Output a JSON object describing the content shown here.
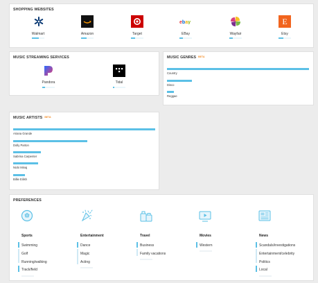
{
  "shopping": {
    "title": "SHOPPING WEBSITES",
    "sites": [
      {
        "name": "Walmart",
        "icon": "walmart-spark-icon",
        "color": "#0b3a74",
        "level": 0.55
      },
      {
        "name": "Amazon",
        "icon": "amazon-smile-icon",
        "color": "#111111",
        "level": 0.45
      },
      {
        "name": "Target",
        "icon": "target-bullseye-icon",
        "color": "#cc0000",
        "level": 0.35
      },
      {
        "name": "EBay",
        "icon": "ebay-logo-icon",
        "color": "#ffffff",
        "level": 0.25
      },
      {
        "name": "Wayfair",
        "icon": "wayfair-pinwheel-icon",
        "color": "#7b2d8e",
        "level": 0.3
      },
      {
        "name": "Etsy",
        "icon": "etsy-e-icon",
        "color": "#f1641e",
        "letter": "E",
        "level": 0.4
      }
    ]
  },
  "music_services": {
    "title": "MUSIC STREAMING SERVICES",
    "services": [
      {
        "name": "Pandora",
        "icon": "pandora-p-icon",
        "color": "#3668ff",
        "level": 0.2
      },
      {
        "name": "Tidal",
        "icon": "tidal-dots-icon",
        "color": "#000000",
        "level": 0.1
      }
    ]
  },
  "music_genres": {
    "title": "MUSIC GENRES",
    "badge": "BETA",
    "items": [
      {
        "name": "Country",
        "value": 1.0
      },
      {
        "name": "Disco",
        "value": 0.17
      },
      {
        "name": "Reggae",
        "value": 0.05
      }
    ]
  },
  "music_artists": {
    "title": "MUSIC ARTISTS",
    "badge": "BETA",
    "items": [
      {
        "name": "Ariana Grande",
        "value": 1.0
      },
      {
        "name": "Dolly Parton",
        "value": 0.51
      },
      {
        "name": "Sabrina Carpenter",
        "value": 0.19
      },
      {
        "name": "Nicki Minaj",
        "value": 0.17
      },
      {
        "name": "Billie Eilish",
        "value": 0.08
      }
    ]
  },
  "preferences": {
    "title": "PREFERENCES",
    "categories": [
      {
        "name": "Sports",
        "icon": "soccer-ball-icon",
        "items": [
          "Swimming",
          "Golf",
          "Running/walking",
          "Track/field"
        ],
        "active": [
          0,
          3
        ]
      },
      {
        "name": "Entertainment",
        "icon": "party-popper-icon",
        "items": [
          "Dance",
          "Magic",
          "Acting"
        ],
        "active": [
          0
        ]
      },
      {
        "name": "Travel",
        "icon": "luggage-icon",
        "items": [
          "Business",
          "Family vacations"
        ],
        "active": [
          0
        ]
      },
      {
        "name": "Movies",
        "icon": "movie-screen-icon",
        "items": [
          "Western"
        ],
        "active": [
          0
        ]
      },
      {
        "name": "News",
        "icon": "newspaper-icon",
        "items": [
          "Scandals/investigations",
          "Entertainment/celebrity",
          "Politics",
          "Local"
        ],
        "active": [
          0,
          3
        ]
      }
    ]
  }
}
